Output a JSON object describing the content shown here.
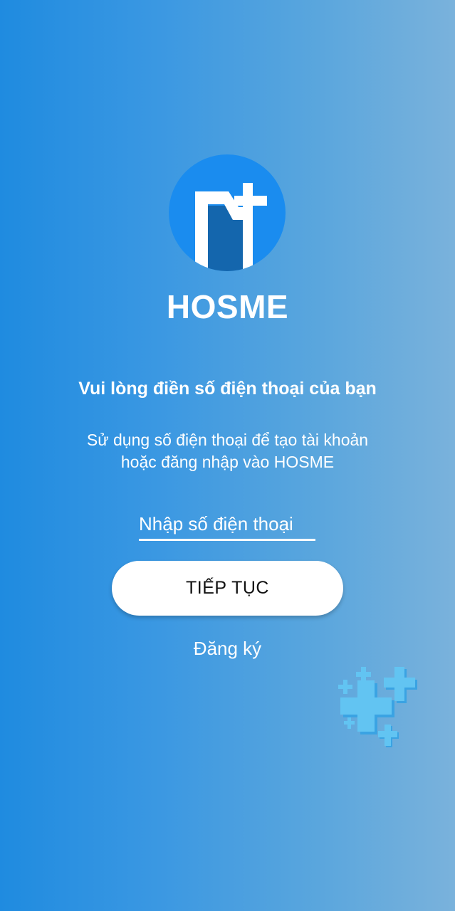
{
  "app": {
    "name": "HOSME",
    "logo_icon": "hosme-logo-icon"
  },
  "headline": "Vui lòng điền số điện thoại của bạn",
  "description": {
    "line1": "Sử dụng số điện thoại để tạo tài khoản",
    "line2": "hoặc đăng nhập vào HOSME"
  },
  "phone_input": {
    "value": "",
    "placeholder": "Nhập số điện thoại"
  },
  "continue_button": {
    "label": "TIẾP TỤC"
  },
  "register_link": {
    "label": "Đăng ký"
  },
  "decoration": {
    "icon": "medical-crosses-icon"
  },
  "colors": {
    "background_start": "#1f8be0",
    "background_end": "#7ab2dc",
    "logo_circle": "#1a8cef",
    "logo_dark": "#1466ad",
    "button_bg": "#ffffff",
    "button_text": "#111111",
    "cross_light": "#5fc3f2"
  }
}
